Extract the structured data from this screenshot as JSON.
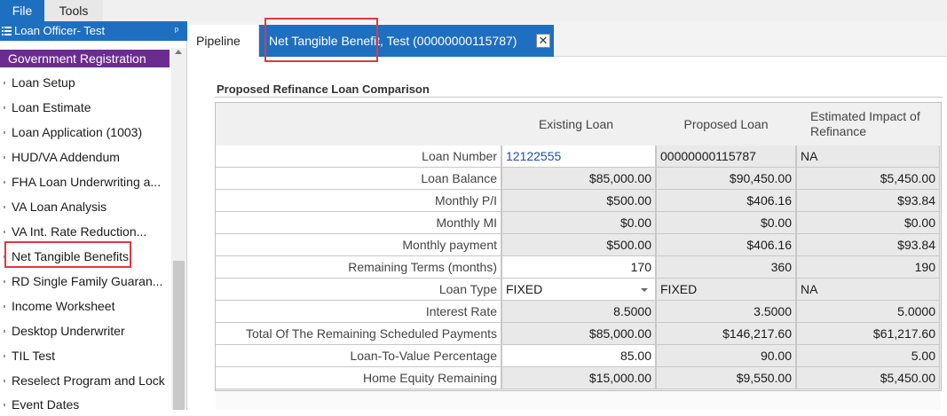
{
  "menu": {
    "file": "File",
    "tools": "Tools"
  },
  "sidebar": {
    "header": "Loan Officer- Test",
    "pin_glyph": "ᵖ",
    "group": "Government Registration",
    "items": [
      "Loan Setup",
      "Loan Estimate",
      "Loan Application (1003)",
      "HUD/VA Addendum",
      "FHA Loan Underwriting a...",
      "VA Loan Analysis",
      "VA Int. Rate Reduction...",
      "Net Tangible Benefits",
      "RD Single Family Guaran...",
      "Income Worksheet",
      "Desktop Underwriter",
      "TIL Test",
      "Reselect Program and Lock",
      "Event Dates"
    ]
  },
  "tabs": {
    "pipeline": "Pipeline",
    "active": "Net Tangible Benefit, Test (00000000115787)",
    "close_glyph": "✕"
  },
  "section": {
    "title": "Proposed Refinance Loan Comparison",
    "columns": {
      "existing": "Existing Loan",
      "proposed": "Proposed Loan",
      "impact": "Estimated Impact of Refinance"
    },
    "rows": [
      {
        "label": "Loan Number",
        "existing": "12122555",
        "proposed": "00000000115787",
        "impact": "NA"
      },
      {
        "label": "Loan Balance",
        "existing": "$85,000.00",
        "proposed": "$90,450.00",
        "impact": "$5,450.00"
      },
      {
        "label": "Monthly P/I",
        "existing": "$500.00",
        "proposed": "$406.16",
        "impact": "$93.84"
      },
      {
        "label": "Monthly MI",
        "existing": "$0.00",
        "proposed": "$0.00",
        "impact": "$0.00"
      },
      {
        "label": "Monthly payment",
        "existing": "$500.00",
        "proposed": "$406.16",
        "impact": "$93.84"
      },
      {
        "label": "Remaining Terms (months)",
        "existing": "170",
        "proposed": "360",
        "impact": "190"
      },
      {
        "label": "Loan Type",
        "existing": "FIXED",
        "proposed": "FIXED",
        "impact": "NA"
      },
      {
        "label": "Interest Rate",
        "existing": "8.5000",
        "proposed": "3.5000",
        "impact": "5.0000"
      },
      {
        "label": "Total Of The Remaining Scheduled Payments",
        "existing": "$85,000.00",
        "proposed": "$146,217.60",
        "impact": "$61,217.60"
      },
      {
        "label": "Loan-To-Value Percentage",
        "existing": "85.00",
        "proposed": "90.00",
        "impact": "5.00"
      },
      {
        "label": "Home Equity Remaining",
        "existing": "$15,000.00",
        "proposed": "$9,550.00",
        "impact": "$5,450.00"
      }
    ]
  },
  "colors": {
    "accent_blue": "#1e6fc0",
    "group_purple": "#6b2c91",
    "highlight_red": "#e0393e"
  }
}
